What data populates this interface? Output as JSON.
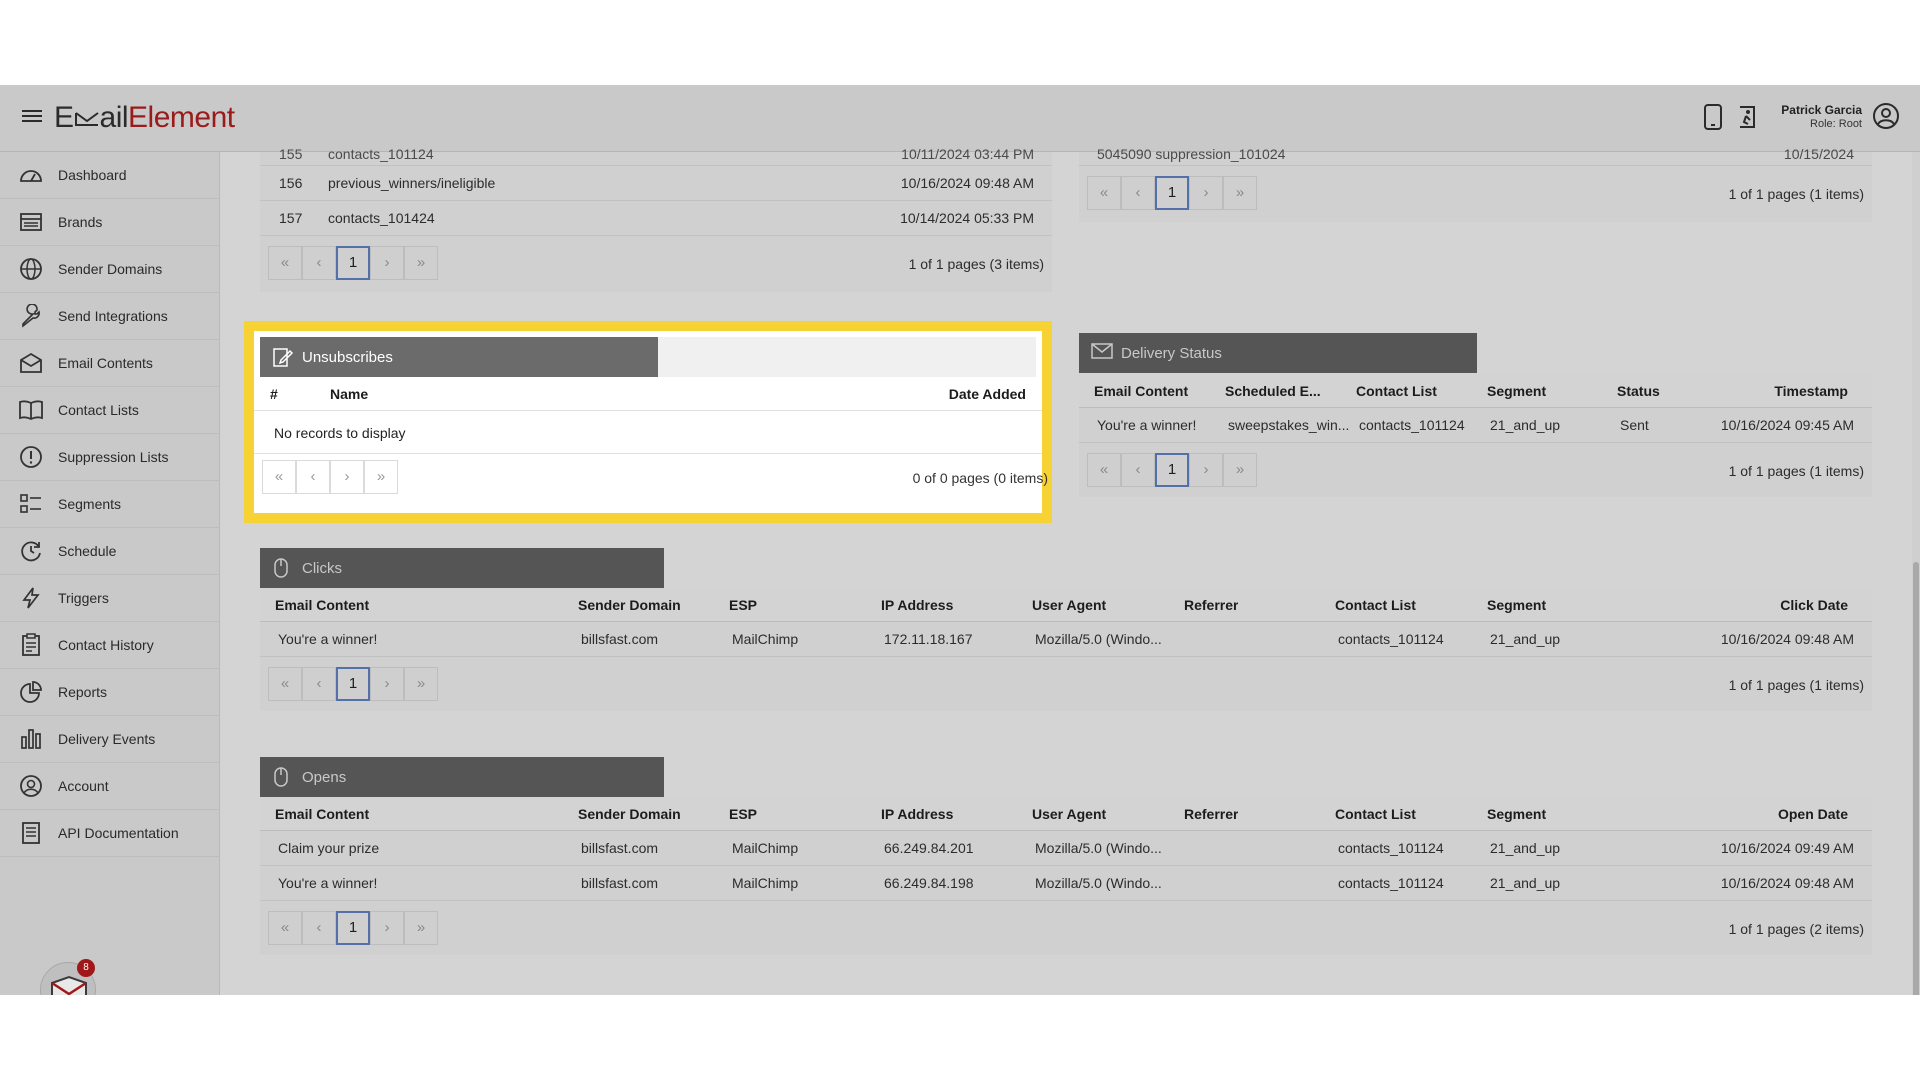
{
  "app": {
    "logo_part1": "E",
    "logo_part2": "ail",
    "logo_part3": "Element",
    "user_name": "Patrick Garcia",
    "user_role": "Role: Root",
    "notification_count": "8"
  },
  "sidebar": {
    "items": [
      {
        "label": "Dashboard",
        "icon": "dashboard-icon"
      },
      {
        "label": "Brands",
        "icon": "brands-icon"
      },
      {
        "label": "Sender Domains",
        "icon": "globe-icon"
      },
      {
        "label": "Send Integrations",
        "icon": "wrench-icon"
      },
      {
        "label": "Email Contents",
        "icon": "envelope-icon"
      },
      {
        "label": "Contact Lists",
        "icon": "book-icon"
      },
      {
        "label": "Suppression Lists",
        "icon": "alert-icon"
      },
      {
        "label": "Segments",
        "icon": "segments-icon"
      },
      {
        "label": "Schedule",
        "icon": "clock-icon"
      },
      {
        "label": "Triggers",
        "icon": "bolt-icon"
      },
      {
        "label": "Contact History",
        "icon": "clipboard-icon"
      },
      {
        "label": "Reports",
        "icon": "pie-chart-icon"
      },
      {
        "label": "Delivery Events",
        "icon": "bar-chart-icon"
      },
      {
        "label": "Account",
        "icon": "user-icon"
      },
      {
        "label": "API Documentation",
        "icon": "document-icon"
      }
    ]
  },
  "contact_lists_panel": {
    "partial_row": {
      "num": "155",
      "name": "contacts_101124",
      "date": "10/11/2024 03:44 PM"
    },
    "rows": [
      {
        "num": "156",
        "name": "previous_winners/ineligible",
        "date": "10/16/2024 09:48 AM"
      },
      {
        "num": "157",
        "name": "contacts_101424",
        "date": "10/14/2024 05:33 PM"
      }
    ],
    "pager": {
      "page": "1",
      "info": "1 of 1 pages (3 items)"
    }
  },
  "suppression_panel": {
    "partial_row": {
      "name": "5045090 suppression_101024",
      "date": "10/15/2024"
    },
    "pager": {
      "page": "1",
      "info": "1 of 1 pages (1 items)"
    }
  },
  "unsubscribes": {
    "title": "Unsubscribes",
    "columns": {
      "num": "#",
      "name": "Name",
      "date": "Date Added"
    },
    "empty_text": "No records to display",
    "pager": {
      "info": "0 of 0 pages (0 items)"
    }
  },
  "delivery_status": {
    "title": "Delivery Status",
    "columns": [
      "Email Content",
      "Scheduled E...",
      "Contact List",
      "Segment",
      "Status",
      "Timestamp"
    ],
    "rows": [
      [
        "You're a winner!",
        "sweepstakes_win...",
        "contacts_101124",
        "21_and_up",
        "Sent",
        "10/16/2024 09:45 AM"
      ]
    ],
    "pager": {
      "page": "1",
      "info": "1 of 1 pages (1 items)"
    }
  },
  "clicks": {
    "title": "Clicks",
    "columns": [
      "Email Content",
      "Sender Domain",
      "ESP",
      "IP Address",
      "User Agent",
      "Referrer",
      "Contact List",
      "Segment",
      "Click Date"
    ],
    "rows": [
      [
        "You're a winner!",
        "billsfast.com",
        "MailChimp",
        "172.11.18.167",
        "Mozilla/5.0 (Windo...",
        "",
        "contacts_101124",
        "21_and_up",
        "10/16/2024 09:48 AM"
      ]
    ],
    "pager": {
      "page": "1",
      "info": "1 of 1 pages (1 items)"
    }
  },
  "opens": {
    "title": "Opens",
    "columns": [
      "Email Content",
      "Sender Domain",
      "ESP",
      "IP Address",
      "User Agent",
      "Referrer",
      "Contact List",
      "Segment",
      "Open Date"
    ],
    "rows": [
      [
        "Claim your prize",
        "billsfast.com",
        "MailChimp",
        "66.249.84.201",
        "Mozilla/5.0 (Windo...",
        "",
        "contacts_101124",
        "21_and_up",
        "10/16/2024 09:49 AM"
      ],
      [
        "You're a winner!",
        "billsfast.com",
        "MailChimp",
        "66.249.84.198",
        "Mozilla/5.0 (Windo...",
        "",
        "contacts_101124",
        "21_and_up",
        "10/16/2024 09:48 AM"
      ]
    ],
    "pager": {
      "page": "1",
      "info": "1 of 1 pages (2 items)"
    }
  },
  "pager_glyphs": {
    "first": "«",
    "prev": "‹",
    "next": "›",
    "last": "»"
  }
}
